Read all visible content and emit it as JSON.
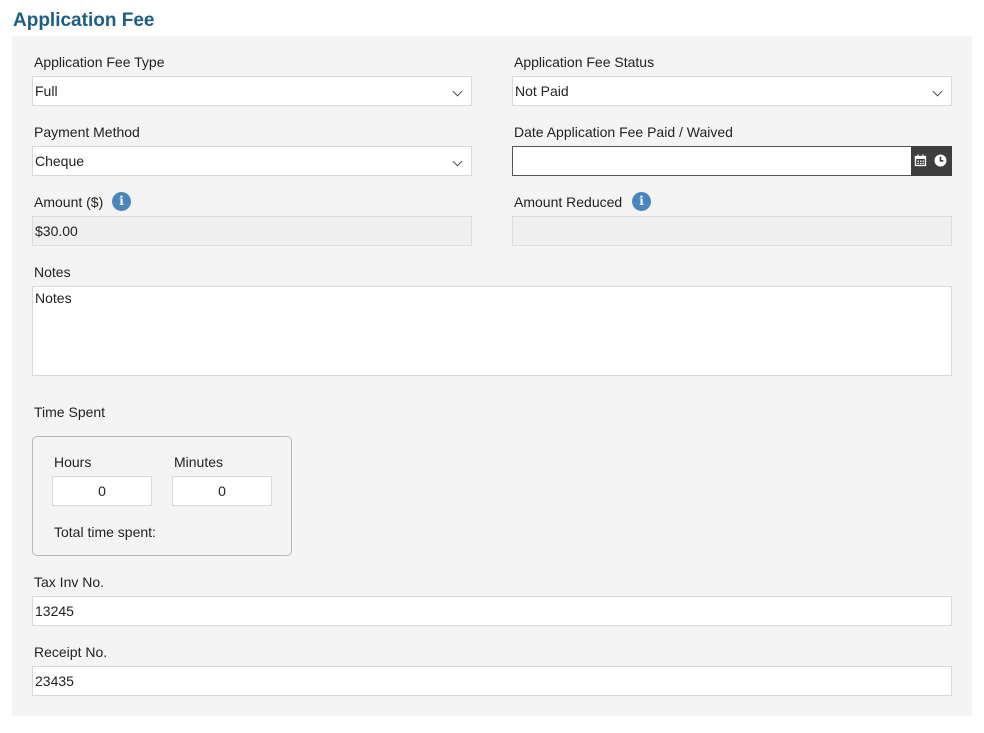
{
  "page": {
    "title": "Application Fee"
  },
  "fee_type": {
    "label": "Application Fee Type",
    "value": "Full"
  },
  "fee_status": {
    "label": "Application Fee Status",
    "value": "Not Paid"
  },
  "payment_method": {
    "label": "Payment Method",
    "value": "Cheque"
  },
  "date_paid": {
    "label": "Date Application Fee Paid / Waived",
    "value": "",
    "calendar_icon": "calendar-icon",
    "clock_icon": "clock-icon"
  },
  "amount": {
    "label": "Amount ($)",
    "value": "$30.00",
    "info_icon": "info-icon"
  },
  "amount_reduced": {
    "label": "Amount Reduced",
    "value": "",
    "info_icon": "info-icon"
  },
  "notes": {
    "label": "Notes",
    "value": "Notes"
  },
  "time_spent": {
    "label": "Time Spent",
    "hours_label": "Hours",
    "hours_value": "0",
    "minutes_label": "Minutes",
    "minutes_value": "0",
    "total_label": "Total time spent:"
  },
  "tax_inv": {
    "label": "Tax Inv No.",
    "value": "13245"
  },
  "receipt": {
    "label": "Receipt No.",
    "value": "23435"
  },
  "colors": {
    "title": "#1d5f84",
    "panel_bg": "#f4f4f4",
    "info_icon": "#4a86be",
    "date_button": "#3e3e3e"
  }
}
